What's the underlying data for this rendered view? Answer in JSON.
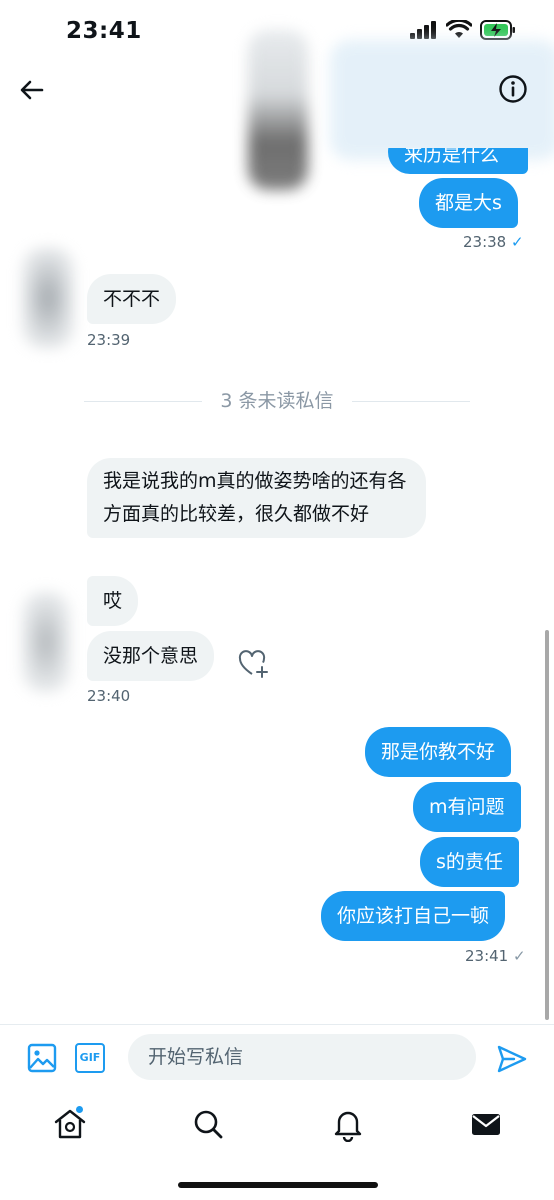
{
  "status_bar": {
    "time": "23:41",
    "icons": [
      "signal-icon",
      "wifi-icon",
      "battery-charging-icon"
    ]
  },
  "header": {
    "back_icon": "back-arrow-icon",
    "info_icon": "info-icon"
  },
  "messages": {
    "out1_partial": "来历是什么",
    "out2": "都是大s",
    "ts1": "23:38",
    "in1": "不不不",
    "ts2": "23:39",
    "unread_divider": "3 条未读私信",
    "in2": "我是说我的m真的做姿势啥的还有各方面真的比较差，很久都做不好",
    "in3": "哎",
    "in4": "没那个意思",
    "ts3": "23:40",
    "out3": "那是你教不好",
    "out4": "m有问题",
    "out5": "s的责任",
    "out6": "你应该打自己一顿",
    "ts4": "23:41",
    "check": "✓"
  },
  "composer": {
    "placeholder": "开始写私信",
    "gif_label": "GIF",
    "image_icon": "image-icon",
    "send_icon": "send-icon"
  },
  "tab_bar": {
    "items": [
      "home-icon",
      "search-icon",
      "notifications-icon",
      "messages-icon"
    ]
  },
  "colors": {
    "accent": "#1d9bf0",
    "incoming_bubble": "#eff3f4",
    "meta_text": "#536471"
  }
}
